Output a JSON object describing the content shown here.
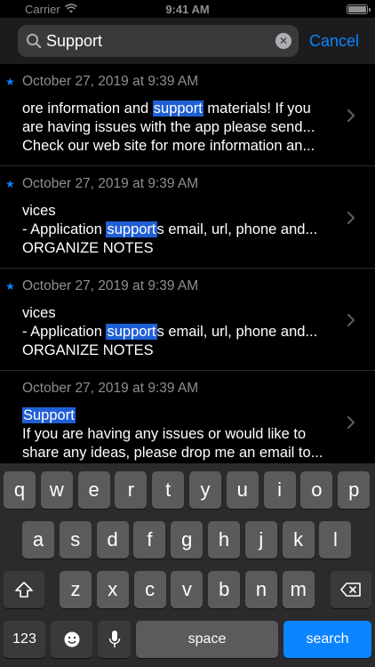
{
  "status_bar": {
    "carrier": "Carrier",
    "time": "9:41 AM"
  },
  "search": {
    "value": "Support",
    "cancel_label": "Cancel"
  },
  "results": [
    {
      "date": "October 27, 2019 at 9:39 AM",
      "unread": true,
      "lines": [
        [
          {
            "t": "ore information and "
          },
          {
            "t": "support",
            "hl": true
          },
          {
            "t": " materials! If you"
          }
        ],
        [
          {
            "t": "are having issues with the app please send..."
          }
        ],
        [
          {
            "t": "Check our web site for more information an..."
          }
        ]
      ]
    },
    {
      "date": "October 27, 2019 at 9:39 AM",
      "unread": true,
      "lines": [
        [
          {
            "t": "vices"
          }
        ],
        [
          {
            "t": "- Application "
          },
          {
            "t": "support",
            "hl": true
          },
          {
            "t": "s email, url, phone and..."
          }
        ],
        [
          {
            "t": "ORGANIZE NOTES"
          }
        ]
      ]
    },
    {
      "date": "October 27, 2019 at 9:39 AM",
      "unread": true,
      "lines": [
        [
          {
            "t": "vices"
          }
        ],
        [
          {
            "t": "- Application "
          },
          {
            "t": "support",
            "hl": true
          },
          {
            "t": "s email, url, phone and..."
          }
        ],
        [
          {
            "t": "ORGANIZE NOTES"
          }
        ]
      ]
    },
    {
      "date": "October 27, 2019 at 9:39 AM",
      "unread": false,
      "lines": [
        [
          {
            "t": "Support",
            "hl": true
          }
        ],
        [
          {
            "t": "If you are having any issues or would like to"
          }
        ],
        [
          {
            "t": "share any ideas, please drop me an email to..."
          }
        ]
      ]
    }
  ],
  "keyboard": {
    "row1": [
      "q",
      "w",
      "e",
      "r",
      "t",
      "y",
      "u",
      "i",
      "o",
      "p"
    ],
    "row2": [
      "a",
      "s",
      "d",
      "f",
      "g",
      "h",
      "j",
      "k",
      "l"
    ],
    "row3": [
      "z",
      "x",
      "c",
      "v",
      "b",
      "n",
      "m"
    ],
    "numbers_label": "123",
    "space_label": "space",
    "search_label": "search"
  },
  "colors": {
    "accent": "#0a84ff",
    "highlight": "#1f5fd6",
    "background": "#000000"
  }
}
